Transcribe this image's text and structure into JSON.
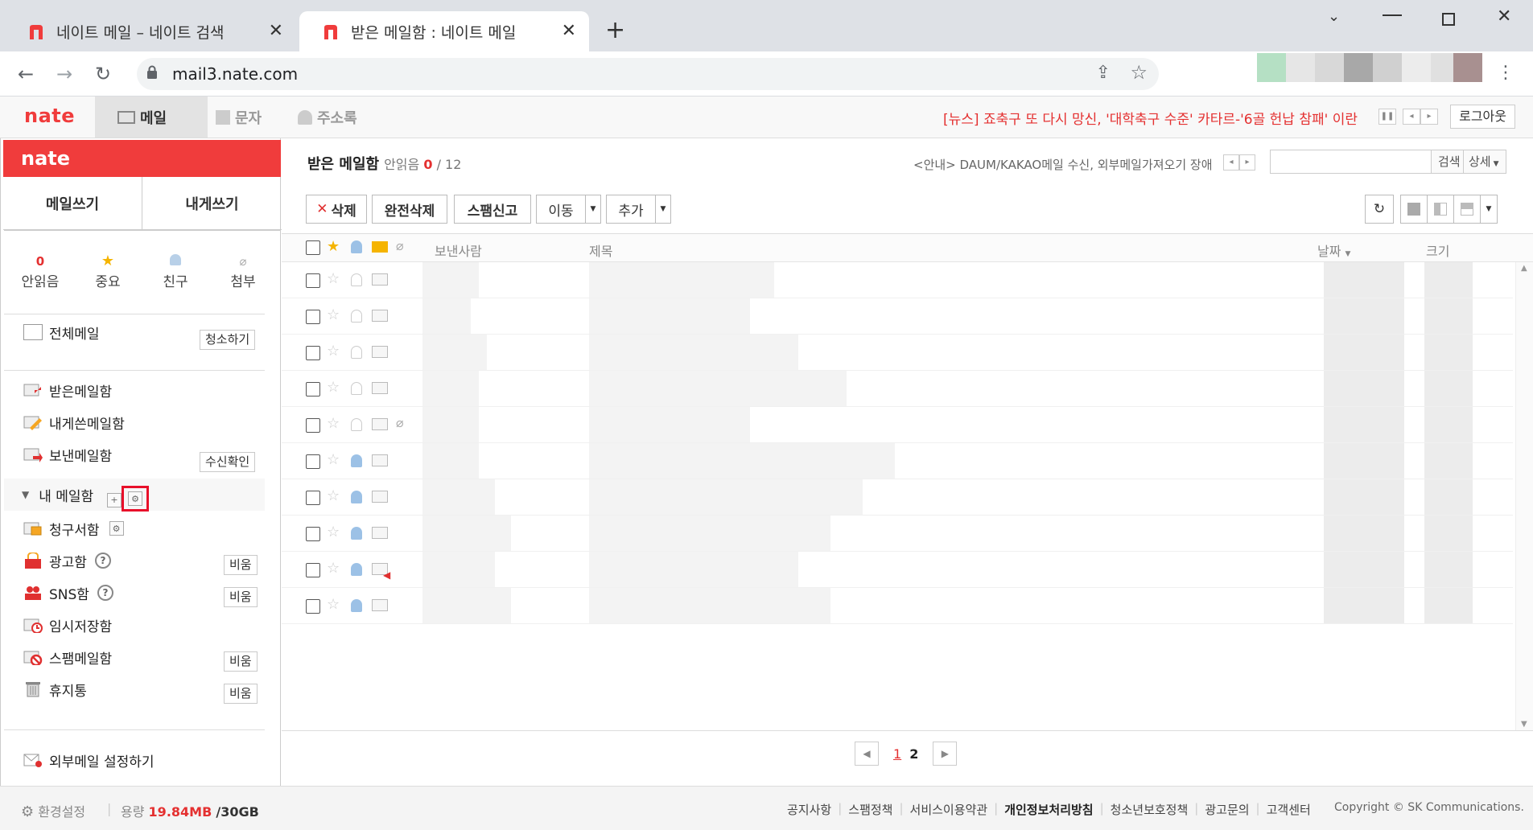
{
  "browser": {
    "tabs": [
      {
        "title": "네이트 메일 – 네이트 검색",
        "active": false
      },
      {
        "title": "받은 메일함 : 네이트 메일",
        "active": true
      }
    ],
    "url": "mail3.nate.com"
  },
  "gnb": {
    "logo": "nate",
    "tabs": [
      "메일",
      "문자",
      "주소록"
    ],
    "ticker": "[뉴스] 죠축구 또 다시 망신, '대학축구 수준' 카타르-'6골 헌납 참패' 이란",
    "logout": "로그아웃"
  },
  "sidebar": {
    "logo": "nate",
    "compose": "메일쓰기",
    "to_self": "내게쓰기",
    "quick": [
      {
        "count": "0",
        "label": "안읽음"
      },
      {
        "label": "중요"
      },
      {
        "label": "친구"
      },
      {
        "label": "첨부"
      }
    ],
    "all_mail": "전체메일",
    "clean_btn": "청소하기",
    "inbox": "받은메일함",
    "self_box": "내게쓴메일함",
    "sent": "보낸메일함",
    "receipt_btn": "수신확인",
    "my_box": "내 메일함",
    "bills": "청구서함",
    "ads": "광고함",
    "sns": "SNS함",
    "drafts": "임시저장함",
    "spam": "스팸메일함",
    "trash": "휴지통",
    "empty_btn": "비움",
    "external": "외부메일 설정하기"
  },
  "main": {
    "title": "받은 메일함",
    "unread_label": "안읽음",
    "unread": "0",
    "total": "/ 12",
    "notice": "<안내> DAUM/KAKAO메일 수신, 외부메일가져오기 장애",
    "search_btn": "검색",
    "detail_btn": "상세",
    "toolbar": {
      "delete": "삭제",
      "perm_delete": "완전삭제",
      "spam_report": "스팸신고",
      "move": "이동",
      "add": "추가"
    },
    "columns": {
      "sender": "보낸사람",
      "subject": "제목",
      "date": "날짜",
      "size": "크기"
    },
    "pages": [
      "1",
      "2"
    ]
  },
  "footer": {
    "settings": "환경설정",
    "usage_label": "용량",
    "used": "19.84MB",
    "quota": "/30GB",
    "links": [
      "공지사항",
      "스팸정책",
      "서비스이용약관",
      "개인정보처리방침",
      "청소년보호정책",
      "광고문의",
      "고객센터"
    ],
    "copyright": "Copyright © SK Communications."
  }
}
